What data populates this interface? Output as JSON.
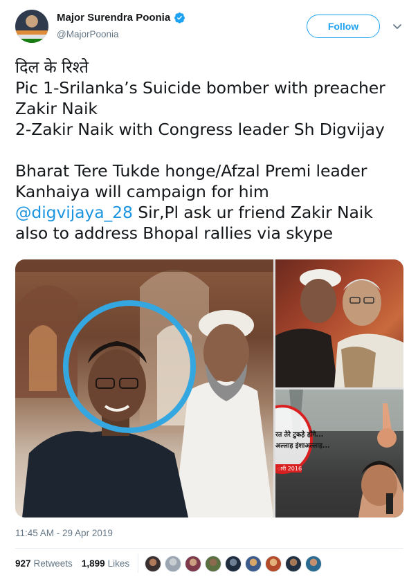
{
  "author": {
    "display_name": "Major Surendra Poonia",
    "handle": "@MajorPoonia",
    "avatar_icon": "profile-avatar",
    "verified_icon": "verified-badge-icon"
  },
  "actions": {
    "follow_label": "Follow",
    "more_icon": "chevron-down-icon"
  },
  "tweet": {
    "lines": [
      "दिल के रिश्ते",
      "Pic 1-Srilanka’s Suicide bomber with preacher",
      "Zakir Naik",
      "2-Zakir Naik with Congress leader Sh Digvijay",
      "",
      "Bharat Tere Tukde honge/Afzal Premi leader",
      "Kanhaiya will campaign for him"
    ],
    "mention": "@digvijaya_28",
    "mention_tail": " Sir,Pl ask ur friend Zakir Naik",
    "last_line": "also to address  Bhopal rallies via skype"
  },
  "media": {
    "photo_overlay_line1": "रत तेरे टुकड़े होंगे...",
    "photo_overlay_line2": "अल्लाह इंशाअल्लाह...",
    "photo_overlay_date": "ारी 2016"
  },
  "timestamp": "11:45 AM - 29 Apr 2019",
  "stats": {
    "retweets_count": "927",
    "retweets_label": "Retweets",
    "likes_count": "1,899",
    "likes_label": "Likes"
  },
  "colors": {
    "accent": "#1da1f2",
    "link": "#1b95e0",
    "muted": "#657786",
    "circle_highlight": "#35a7e0"
  }
}
